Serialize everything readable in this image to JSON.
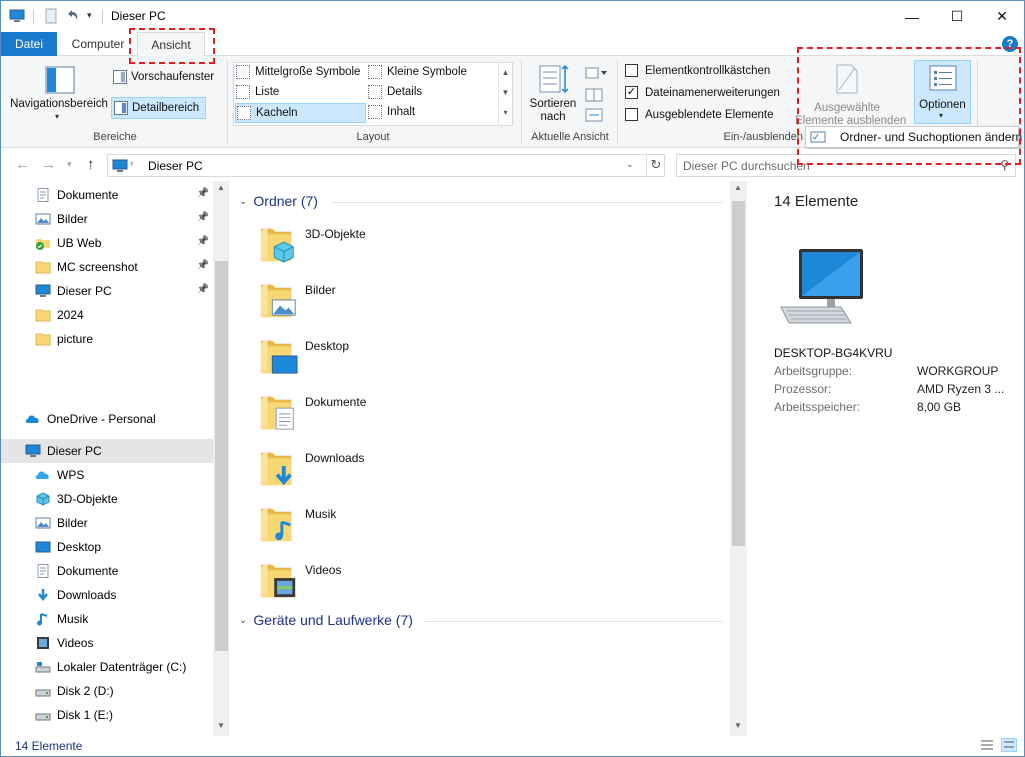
{
  "window": {
    "title": "Dieser PC",
    "controls": {
      "minimize": "—",
      "maximize": "☐",
      "close": "✕"
    }
  },
  "ribbon_tabs": {
    "file": "Datei",
    "computer": "Computer",
    "view": "Ansicht",
    "help": "?"
  },
  "ribbon": {
    "panes": {
      "navigation_pane": "Navigationsbereich",
      "preview_pane": "Vorschaufenster",
      "details_pane": "Detailbereich",
      "group_label": "Bereiche"
    },
    "layout": {
      "options": [
        "Mittelgroße Symbole",
        "Kleine Symbole",
        "Liste",
        "Details",
        "Kacheln",
        "Inhalt"
      ],
      "selected": "Kacheln",
      "group_label": "Layout"
    },
    "current_view": {
      "sort_line1": "Sortieren",
      "sort_line2": "nach",
      "group_label": "Aktuelle Ansicht"
    },
    "show_hide": {
      "item_checkboxes": "Elementkontrollkästchen",
      "file_name_extensions": "Dateinamenerweiterungen",
      "hidden_items": "Ausgeblendete Elemente",
      "hide_selected_line1": "Ausgewählte",
      "hide_selected_line2": "Elemente ausblenden",
      "group_label": "Ein-/ausblenden",
      "checked": {
        "item_checkboxes": false,
        "file_name_extensions": true,
        "hidden_items": false
      }
    },
    "options": {
      "label": "Optionen",
      "menu_item": "Ordner- und Suchoptionen ändern"
    }
  },
  "address_bar": {
    "path": "Dieser PC",
    "search_placeholder": "Dieser PC durchsuchen"
  },
  "nav_pane": {
    "quick_access": [
      {
        "label": "Dokumente",
        "icon": "documents-icon",
        "pinned": true
      },
      {
        "label": "Bilder",
        "icon": "pictures-icon",
        "pinned": true
      },
      {
        "label": "UB Web",
        "icon": "folder-synced-icon",
        "pinned": true
      },
      {
        "label": "MC screenshot",
        "icon": "folder-icon",
        "pinned": true
      },
      {
        "label": "Dieser PC",
        "icon": "computer-icon",
        "pinned": true
      },
      {
        "label": "2024",
        "icon": "folder-icon",
        "pinned": false
      },
      {
        "label": "picture",
        "icon": "folder-icon",
        "pinned": false
      }
    ],
    "onedrive": "OneDrive - Personal",
    "this_pc": "Dieser PC",
    "this_pc_items": [
      {
        "label": "WPS",
        "icon": "cloud-icon"
      },
      {
        "label": "3D-Objekte",
        "icon": "3d-objects-icon"
      },
      {
        "label": "Bilder",
        "icon": "pictures-icon"
      },
      {
        "label": "Desktop",
        "icon": "desktop-icon"
      },
      {
        "label": "Dokumente",
        "icon": "documents-icon"
      },
      {
        "label": "Downloads",
        "icon": "downloads-icon"
      },
      {
        "label": "Musik",
        "icon": "music-icon"
      },
      {
        "label": "Videos",
        "icon": "videos-icon"
      },
      {
        "label": "Lokaler Datenträger (C:)",
        "icon": "drive-c-icon"
      },
      {
        "label": "Disk 2 (D:)",
        "icon": "drive-icon"
      },
      {
        "label": "Disk 1 (E:)",
        "icon": "drive-icon"
      }
    ]
  },
  "content": {
    "folders_header": "Ordner (7)",
    "folders": [
      {
        "name": "3D-Objekte",
        "overlay": "3d"
      },
      {
        "name": "Bilder",
        "overlay": "pictures"
      },
      {
        "name": "Desktop",
        "overlay": "desktop"
      },
      {
        "name": "Dokumente",
        "overlay": "documents"
      },
      {
        "name": "Downloads",
        "overlay": "downloads"
      },
      {
        "name": "Musik",
        "overlay": "music"
      },
      {
        "name": "Videos",
        "overlay": "videos"
      }
    ],
    "devices_header": "Geräte und Laufwerke (7)"
  },
  "details_pane": {
    "count": "14 Elemente",
    "computer_name": "DESKTOP-BG4KVRU",
    "rows": [
      {
        "label": "Arbeitsgruppe:",
        "value": "WORKGROUP"
      },
      {
        "label": "Prozessor:",
        "value": "AMD Ryzen 3 ..."
      },
      {
        "label": "Arbeitsspeicher:",
        "value": "8,00 GB"
      }
    ]
  },
  "status_bar": {
    "count": "14 Elemente"
  },
  "colors": {
    "accent": "#1979ca",
    "highlight": "#e02020",
    "selection": "#cce8ff",
    "group_header": "#1e3287",
    "folder": "#f8d775"
  }
}
